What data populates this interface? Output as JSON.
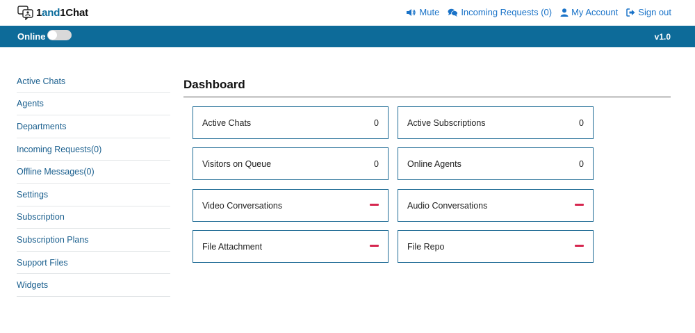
{
  "app": {
    "logo_text_1": "1",
    "logo_text_accent": "and",
    "logo_text_2": "1Chat"
  },
  "topnav": {
    "mute": "Mute",
    "incoming": "Incoming Requests (0)",
    "account": "My Account",
    "signout": "Sign out"
  },
  "status": {
    "label": "Online",
    "version": "v1.0",
    "toggle_on": false
  },
  "sidebar": {
    "items": [
      {
        "label": "Active Chats"
      },
      {
        "label": "Agents"
      },
      {
        "label": "Departments"
      },
      {
        "label": "Incoming Requests(0)"
      },
      {
        "label": "Offline Messages(0)"
      },
      {
        "label": "Settings"
      },
      {
        "label": "Subscription"
      },
      {
        "label": "Subscription Plans"
      },
      {
        "label": "Support Files"
      },
      {
        "label": "Widgets"
      }
    ]
  },
  "dashboard": {
    "title": "Dashboard",
    "cards": [
      {
        "label": "Active Chats",
        "value": "0"
      },
      {
        "label": "Active Subscriptions",
        "value": "0"
      },
      {
        "label": "Visitors on Queue",
        "value": "0"
      },
      {
        "label": "Online Agents",
        "value": "0"
      },
      {
        "label": "Video Conversations",
        "status": "disabled"
      },
      {
        "label": "Audio Conversations",
        "status": "disabled"
      },
      {
        "label": "File Attachment",
        "status": "disabled"
      },
      {
        "label": "File Repo",
        "status": "disabled"
      }
    ]
  },
  "colors": {
    "brand": "#0d6b99",
    "link": "#1a73c8",
    "disabled_dash": "#d6264f"
  }
}
